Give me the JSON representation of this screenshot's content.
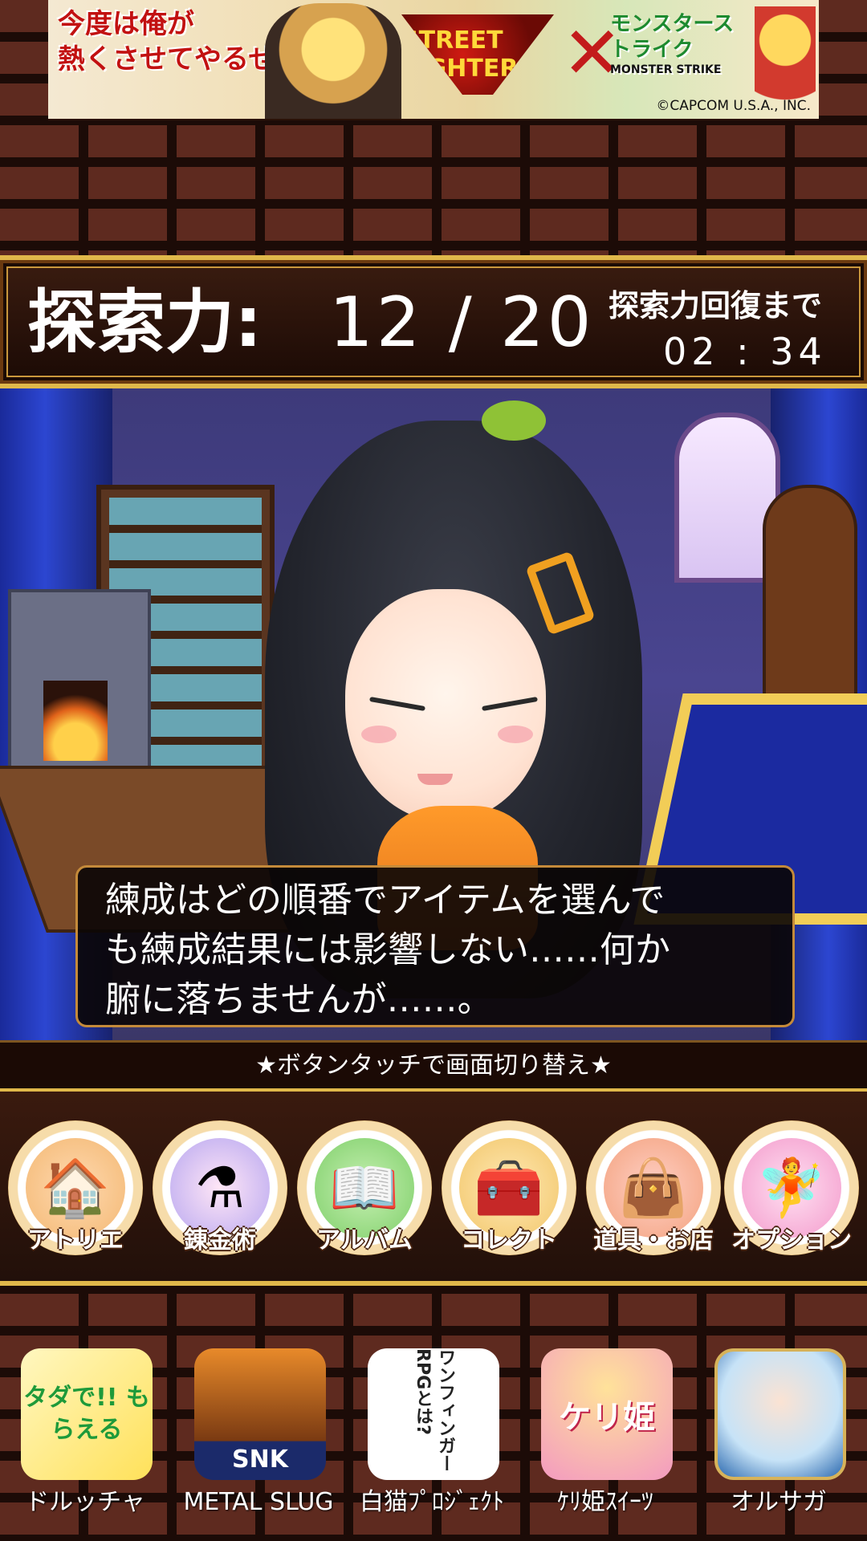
{
  "ad_banner": {
    "headline_line1": "今度は俺が",
    "headline_line2": "熱くさせてやるぜ!",
    "street_fighter_logo": "STREET FIGHTER V",
    "monster_strike_logo": "モンスターストライク",
    "monster_strike_sub": "MONSTER STRIKE",
    "copyright": "©CAPCOM U.S.A., INC."
  },
  "status": {
    "search_power_label": "探索力:",
    "search_power_value": "12 / 20",
    "recovery_label": "探索力回復まで",
    "recovery_time": "02 : 34"
  },
  "dialog": {
    "text": "練成はどの順番でアイテムを選んで\nも練成結果には影響しない……何か\n腑に落ちませんが……。"
  },
  "hint": "★ボタンタッチで画面切り替え★",
  "menu": [
    {
      "label": "アトリエ",
      "icon": "house-icon"
    },
    {
      "label": "錬金術",
      "icon": "potion-icon"
    },
    {
      "label": "アルバム",
      "icon": "book-icon"
    },
    {
      "label": "コレクト",
      "icon": "treasure-chest-icon"
    },
    {
      "label": "道具・お店",
      "icon": "bag-icon"
    },
    {
      "label": "オプション",
      "icon": "fairy-icon"
    }
  ],
  "apps": [
    {
      "name": "ドルッチャ",
      "icon_text": "タダで!! もらえる"
    },
    {
      "name": "METAL SLUG",
      "icon_text": "SNK"
    },
    {
      "name": "白猫ﾌﾟﾛｼﾞｪｸﾄ",
      "icon_text": "ワンフィンガー RPGとは?"
    },
    {
      "name": "ｹﾘ姫ｽｲｰﾂ",
      "icon_text": "ケリ姫"
    },
    {
      "name": "オルサガ",
      "icon_text": ""
    }
  ],
  "colors": {
    "gold_frame": "#e0b84a",
    "dark_panel": "#1b0a05",
    "brick": "#5e2a1f"
  }
}
